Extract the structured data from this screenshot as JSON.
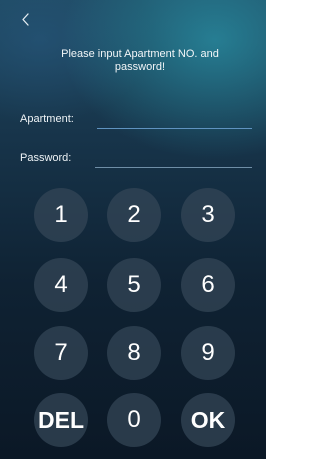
{
  "header": {
    "back_icon": "chevron-left-icon",
    "prompt": "Please input Apartment NO. and password!"
  },
  "form": {
    "apartment_label": "Apartment:",
    "apartment_value": "",
    "password_label": "Password:",
    "password_value": ""
  },
  "keypad": {
    "keys": [
      "1",
      "2",
      "3",
      "4",
      "5",
      "6",
      "7",
      "8",
      "9",
      "DEL",
      "0",
      "OK"
    ]
  }
}
